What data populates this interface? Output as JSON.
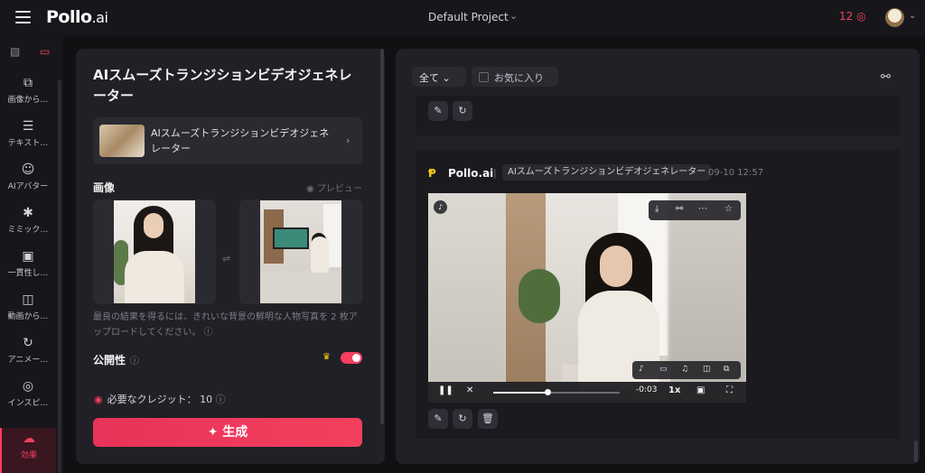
{
  "topbar": {
    "logo": "Pollo",
    "logo_suffix": ".ai",
    "project": "Default Project",
    "credits": "12",
    "credits_icon": "coin-icon"
  },
  "sidebar": {
    "items": [
      {
        "label": "画像から…",
        "icon": "image-to-video-icon"
      },
      {
        "label": "テキスト…",
        "icon": "text-to-video-icon"
      },
      {
        "label": "AIアバター",
        "icon": "avatar-icon"
      },
      {
        "label": "ミミック…",
        "icon": "mimic-icon"
      },
      {
        "label": "一貫性し…",
        "icon": "consistency-icon"
      },
      {
        "label": "動画から…",
        "icon": "video-to-video-icon"
      },
      {
        "label": "アニメー…",
        "icon": "animation-icon"
      },
      {
        "label": "インスピ…",
        "icon": "compass-icon"
      },
      {
        "label": "効果",
        "icon": "effects-icon"
      }
    ]
  },
  "leftpanel": {
    "title": "AIスムーズトランジションビデオジェネレーター",
    "model_name": "AIスムーズトランジションビデオジェネレーター",
    "image_label": "画像",
    "preview": "プレビュー",
    "hint": "最良の結果を得るには、きれいな背景の鮮明な人物写真を 2 枚アップロードしてください。",
    "public_label": "公開性",
    "credit_label": "必要なクレジット：",
    "credit_value": "10",
    "generate": "生成"
  },
  "rightpanel": {
    "filter": "全て",
    "favorites": "お気に入り",
    "brand": "Pollo.ai",
    "model_chip": "AIスムーズトランジションビデオジェネレーター",
    "timestamp": "09-10 12:57",
    "video": {
      "time": "-0:03",
      "speed": "1x",
      "progress": 0.43
    }
  },
  "colors": {
    "accent": "#f43f5e",
    "panel": "#202026",
    "background": "#111114"
  }
}
